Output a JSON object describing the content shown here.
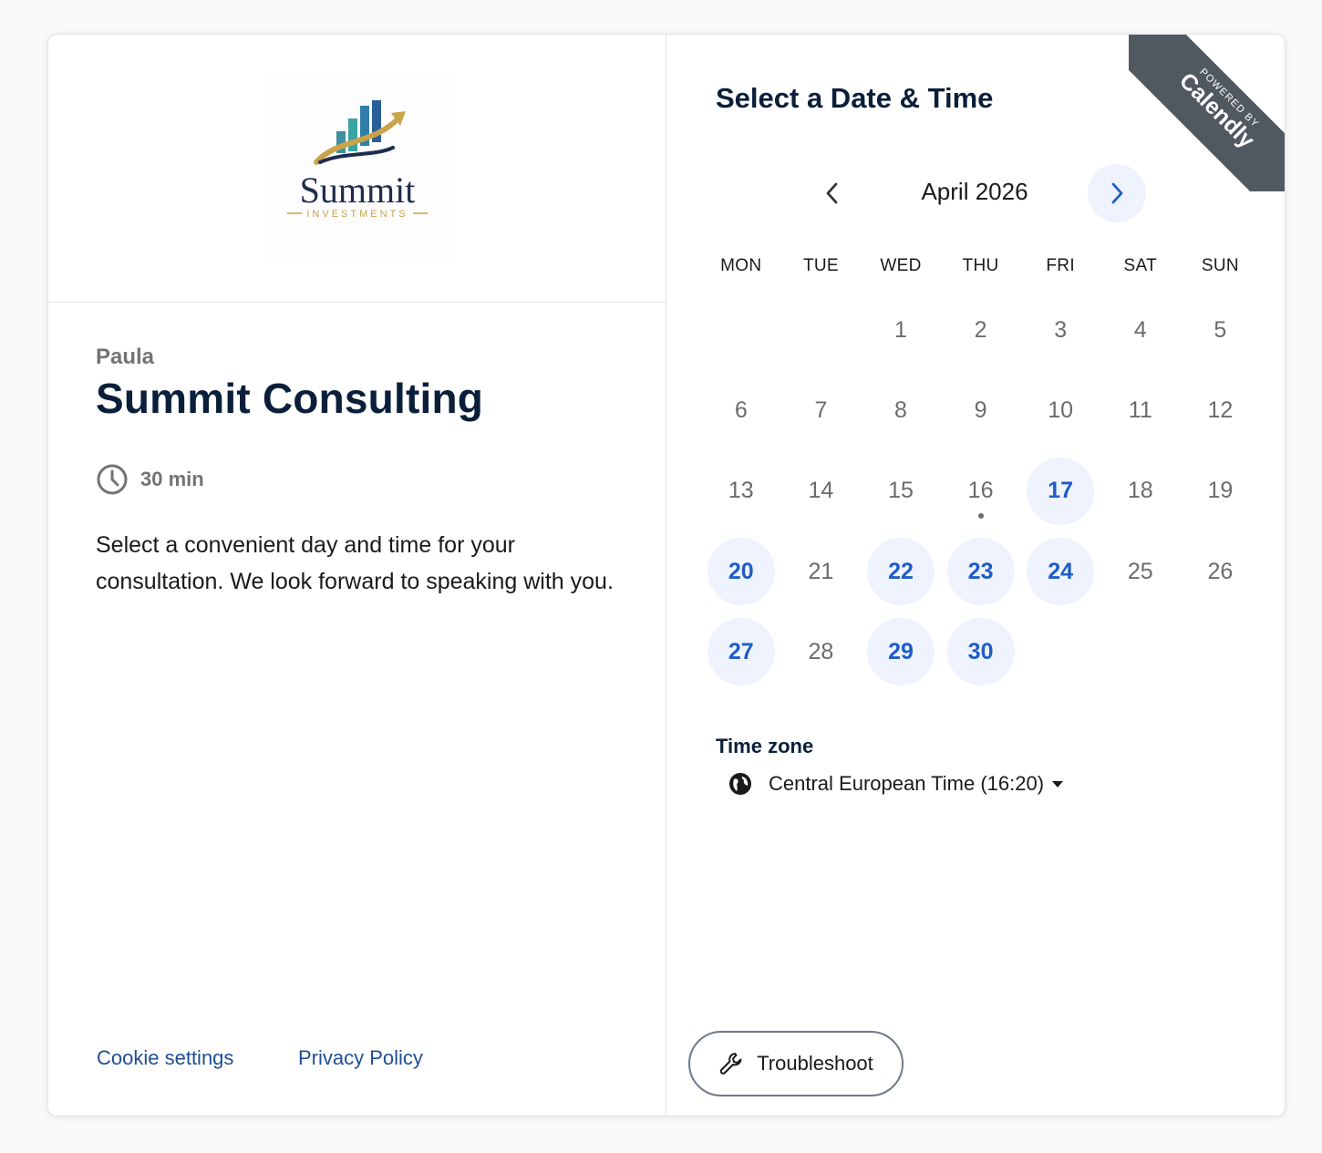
{
  "logo": {
    "name": "Summit",
    "tagline": "INVESTMENTS"
  },
  "event": {
    "host": "Paula",
    "title": "Summit Consulting",
    "duration": "30 min",
    "description": "Select a convenient day and time for your consultation. We look forward to speaking with you."
  },
  "footer": {
    "cookie_settings": "Cookie settings",
    "privacy_policy": "Privacy Policy"
  },
  "badge": {
    "powered_by": "POWERED BY",
    "brand": "Calendly"
  },
  "calendar": {
    "heading": "Select a Date & Time",
    "month_label": "April 2026",
    "weekdays": [
      "MON",
      "TUE",
      "WED",
      "THU",
      "FRI",
      "SAT",
      "SUN"
    ],
    "leading_blanks": 2,
    "days": [
      {
        "n": "1",
        "available": false
      },
      {
        "n": "2",
        "available": false
      },
      {
        "n": "3",
        "available": false
      },
      {
        "n": "4",
        "available": false
      },
      {
        "n": "5",
        "available": false
      },
      {
        "n": "6",
        "available": false
      },
      {
        "n": "7",
        "available": false
      },
      {
        "n": "8",
        "available": false
      },
      {
        "n": "9",
        "available": false
      },
      {
        "n": "10",
        "available": false
      },
      {
        "n": "11",
        "available": false
      },
      {
        "n": "12",
        "available": false
      },
      {
        "n": "13",
        "available": false
      },
      {
        "n": "14",
        "available": false
      },
      {
        "n": "15",
        "available": false
      },
      {
        "n": "16",
        "available": false,
        "today": true
      },
      {
        "n": "17",
        "available": true
      },
      {
        "n": "18",
        "available": false
      },
      {
        "n": "19",
        "available": false
      },
      {
        "n": "20",
        "available": true
      },
      {
        "n": "21",
        "available": false
      },
      {
        "n": "22",
        "available": true
      },
      {
        "n": "23",
        "available": true
      },
      {
        "n": "24",
        "available": true
      },
      {
        "n": "25",
        "available": false
      },
      {
        "n": "26",
        "available": false
      },
      {
        "n": "27",
        "available": true
      },
      {
        "n": "28",
        "available": false
      },
      {
        "n": "29",
        "available": true
      },
      {
        "n": "30",
        "available": true
      }
    ]
  },
  "timezone": {
    "label": "Time zone",
    "value": "Central European Time (16:20)"
  },
  "troubleshoot": {
    "label": "Troubleshoot"
  },
  "colors": {
    "accent": "#1f5cc7",
    "available_bg": "#eef3fd",
    "title": "#0b1f3a",
    "link": "#1f4e95",
    "badge_bg": "#505860"
  }
}
